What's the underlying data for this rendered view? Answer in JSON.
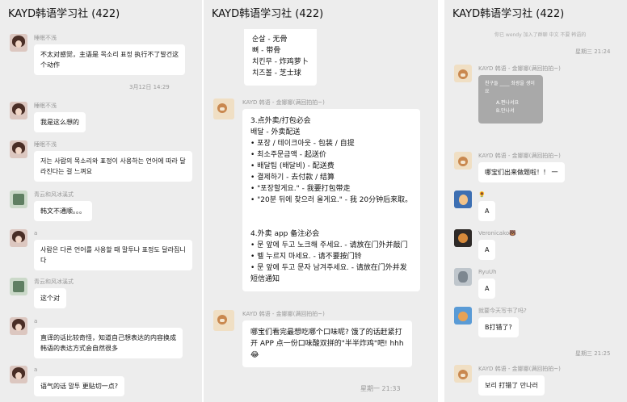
{
  "chat_title": "KAYD韩语学习社 (422)",
  "left": {
    "messages": [
      {
        "name": "睡眠不浅",
        "text": "不太对感觉，主语是 목소리 표정 执行不了발건这\n个动作"
      },
      {
        "name": "睡眠不浅",
        "text": "我是这么想的"
      },
      {
        "name": "睡眠不浅",
        "text": "저는 사람의 목소리와 표정이 사용하는 언어에 따라 달\n라진다는 걸 느껴요"
      },
      {
        "name": "青云和风冰溪式",
        "text": "韩文不通顺。。。"
      },
      {
        "name": "a",
        "text": "사람은 다른 언어를 사용할 때 말투나 표정도 달라집니\n다"
      },
      {
        "name": "青云和风冰溪式",
        "text": "这个对"
      },
      {
        "name": "a",
        "text": "直译的话比较奇怪，知道自己想表达的内容换成\n韩语的表达方式会自然很多"
      },
      {
        "name": "a",
        "text": "语气的话 말투 更贴切一点?"
      }
    ],
    "timestamp": "3月12日 14:29"
  },
  "middle": {
    "top_text": "순살 - 无骨\n뼈 - 带骨\n치킨무 - 炸鸡萝卜\n치즈볼 - 芝士球",
    "sender": "KAYD 韩语 - 金娜娜(满回拍拍~)",
    "big_text": "3.点外卖/打包必会\n배달 - 外卖配送\n• 포장 / 테이크아웃 - 包装 / 自提\n• 최소주문금액 - 起送价\n• 배달팁 (배달비) - 配送费\n• 결제하기 - 去付款 / 结算\n• \"포장할게요.\" - 我要打包带走\n• \"20분 뒤에 찾으러 올게요.\" - 我 20分钟后来取。\n\n\n4.外卖 app 备注必会\n• 문 앞에 두고 노크해 주세요. - 请放在门外并敲门\n• 벨 누르지 마세요. - 请不要按门铃\n• 문 앞에 두고 문자 남겨주세요. - 请放在门外并发\n短信通知",
    "sender2": "KAYD 韩语 - 金娜娜(满回拍拍~)",
    "last_text": "哪宝们看完最想吃哪个口味呢? 饿了的话赶紧打\n开 APP 点一份口味酸双拼的\"半半炸鸡\"吧! hhh\n😂",
    "timestamp": "星期一 21:33"
  },
  "right": {
    "top_cut": "你已 wendy 加入了群聊 中文 不要 韩语的",
    "timestamp1": "星期三 21:24",
    "image_card": {
      "question": "친구들 ____ 좌광을 생이요",
      "options": [
        "A.편나서요",
        "B.만나서"
      ]
    },
    "messages": [
      {
        "name": "KAYD 韩语 - 金娜娜(满回拍拍~)",
        "text": "哪宝们出来做题啦！！ 一"
      },
      {
        "name": "🌻",
        "text": "A"
      },
      {
        "name": "Veronicako🐻",
        "text": "A"
      },
      {
        "name": "RyuUh",
        "text": "A"
      },
      {
        "name": "就要今天写书了吗?",
        "text": "B打错了?"
      },
      {
        "name": "KAYD 韩语 - 金娜娜(满回拍拍~)",
        "text": "보리 打错了 만나러"
      }
    ],
    "timestamp2": "星期三 21:25"
  }
}
